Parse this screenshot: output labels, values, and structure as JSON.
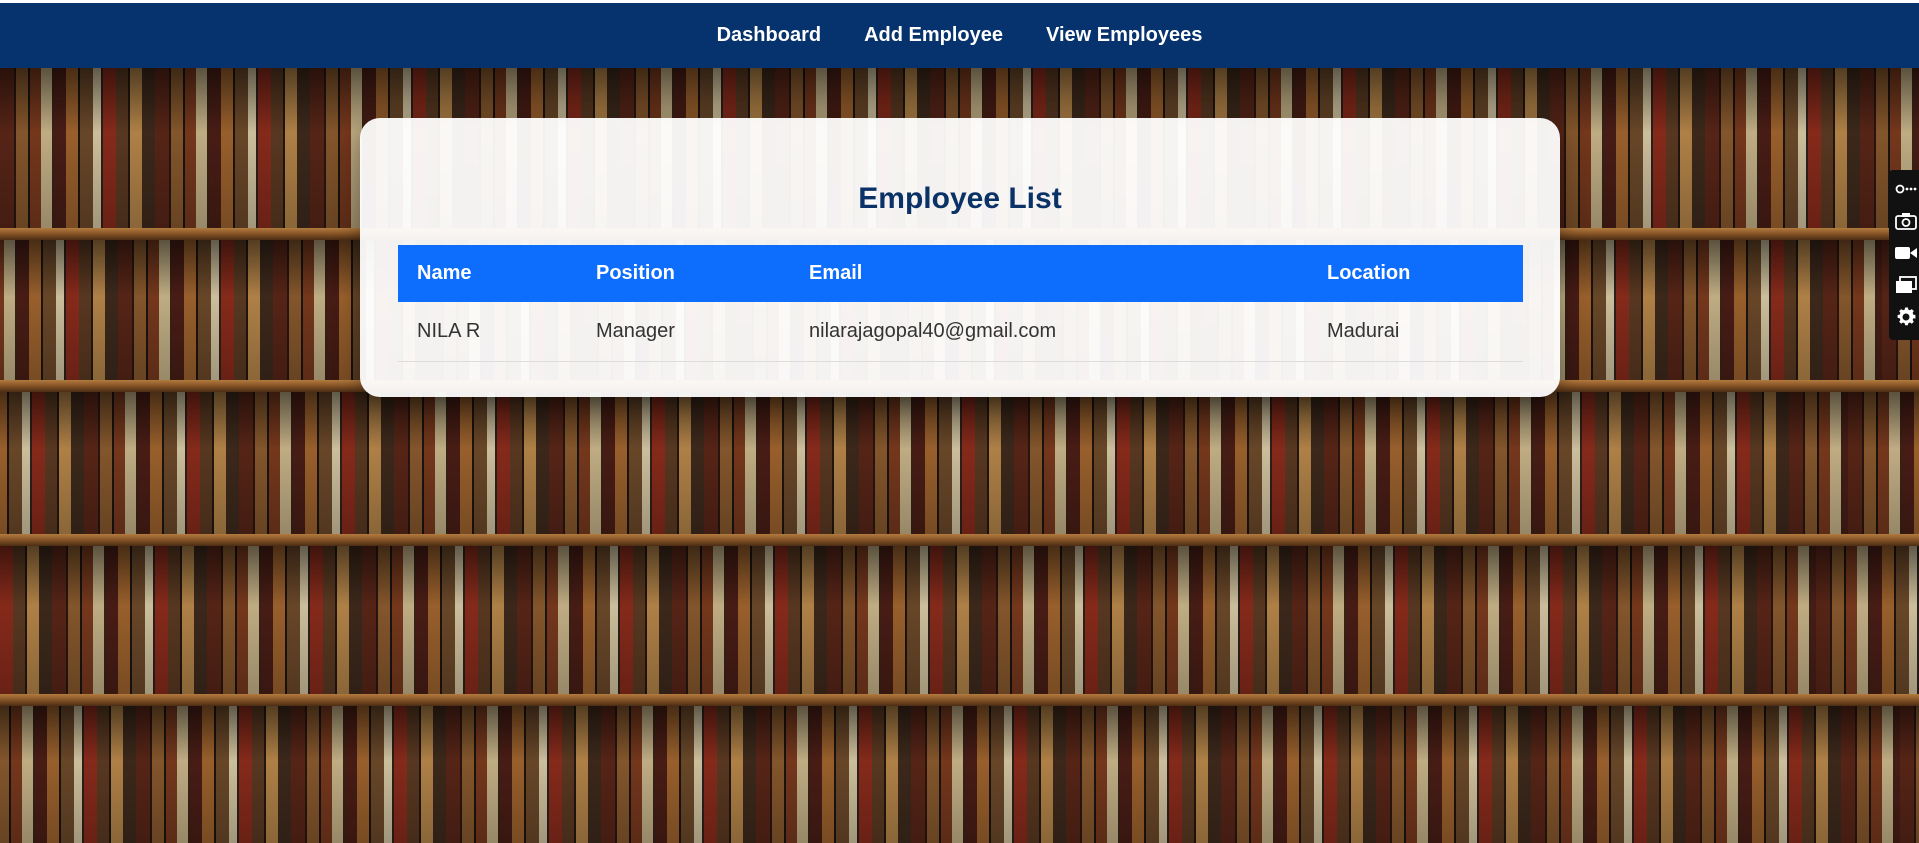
{
  "nav": {
    "items": [
      {
        "label": "Dashboard"
      },
      {
        "label": "Add Employee"
      },
      {
        "label": "View Employees"
      }
    ]
  },
  "employee_list": {
    "title": "Employee List",
    "columns": [
      "Name",
      "Position",
      "Email",
      "Location"
    ],
    "rows": [
      {
        "name": "NILA R",
        "position": "Manager",
        "email": "nilarajagopal40@gmail.com",
        "location": "Madurai"
      }
    ]
  },
  "side_toolbar": {
    "tools": [
      "link-icon",
      "camera-icon",
      "video-icon",
      "window-icon",
      "gear-icon"
    ]
  },
  "colors": {
    "navbar": "#06326e",
    "table_header": "#0d6efd",
    "title": "#0a3266"
  }
}
